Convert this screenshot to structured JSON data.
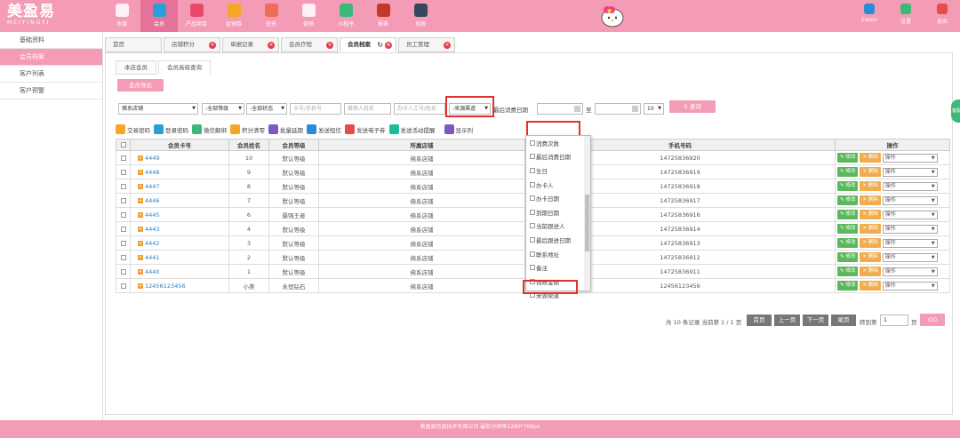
{
  "app": {
    "logo_cn": "美盈易",
    "logo_en": "MEIYINGYI"
  },
  "nav": [
    {
      "label": "收银",
      "icon": "cash-register-icon",
      "color": "#ffffff"
    },
    {
      "label": "会员",
      "icon": "member-icon",
      "color": "#2aa0d8"
    },
    {
      "label": "产品项目",
      "icon": "product-icon",
      "color": "#e84b6a"
    },
    {
      "label": "促销券",
      "icon": "coupon-icon",
      "color": "#f5a623"
    },
    {
      "label": "短充",
      "icon": "recharge-icon",
      "color": "#ef6b5a"
    },
    {
      "label": "营销",
      "icon": "marketing-icon",
      "color": "#ffffff"
    },
    {
      "label": "小程序",
      "icon": "mini-program-icon",
      "color": "#3cb878"
    },
    {
      "label": "报表",
      "icon": "report-icon",
      "color": "#c0392b"
    },
    {
      "label": "系统",
      "icon": "system-icon",
      "color": "#34495e"
    }
  ],
  "topright": [
    {
      "label": "Eason",
      "icon": "user-icon",
      "color": "#2a8cd8"
    },
    {
      "label": "设置",
      "icon": "settings-icon",
      "color": "#3cb878"
    },
    {
      "label": "退出",
      "icon": "logout-icon",
      "color": "#e84b4b"
    }
  ],
  "sidebar": [
    {
      "label": "基础资料"
    },
    {
      "label": "会员档案"
    },
    {
      "label": "客户列表"
    },
    {
      "label": "客户预警"
    }
  ],
  "tabs": [
    {
      "label": "首页",
      "w": 64
    },
    {
      "label": "店铺积分",
      "w": 64
    },
    {
      "label": "单据记录",
      "w": 64
    },
    {
      "label": "会员疗程",
      "w": 64
    },
    {
      "label": "会员档案",
      "w": 64
    },
    {
      "label": "员工管理",
      "w": 64
    }
  ],
  "subtabs": [
    "本店会员",
    "会员高级查询"
  ],
  "export_btn": "会员导出",
  "filters": {
    "store": "佛系店铺",
    "level": "-全部等级",
    "status": "-全部状态",
    "card_placeholder": "卡号/手机号",
    "recommender_placeholder": "推荐人姓名",
    "staff_placeholder": "办卡人工号/姓名",
    "source": "-来源渠道",
    "last_consume_label": "最后消费日期",
    "to_label": "至",
    "page_size": "10",
    "query_btn": "查询"
  },
  "quick": [
    {
      "label": "交易密码",
      "color": "#f5a623"
    },
    {
      "label": "登录密码",
      "color": "#2aa0d8"
    },
    {
      "label": "微信解绑",
      "color": "#3cb878"
    },
    {
      "label": "积分清零",
      "color": "#f5a623"
    },
    {
      "label": "批量延期",
      "color": "#7e57c2"
    },
    {
      "label": "发送短信",
      "color": "#2a8cd8"
    },
    {
      "label": "发送电子券",
      "color": "#e84b4b"
    },
    {
      "label": "发送活动提醒",
      "color": "#1abc9c"
    },
    {
      "label": "显示列",
      "color": "#7e57c2"
    }
  ],
  "table": {
    "headers": [
      "会员卡号",
      "会员姓名",
      "会员等级",
      "所属店铺",
      "手机号码",
      "操作"
    ],
    "edit": "修改",
    "delete": "删除",
    "op": "操作",
    "rows": [
      {
        "card": "4449",
        "name": "10",
        "level": "默认等级",
        "store": "佛系店铺",
        "phone": "14725836920"
      },
      {
        "card": "4448",
        "name": "9",
        "level": "默认等级",
        "store": "佛系店铺",
        "phone": "14725836919"
      },
      {
        "card": "4447",
        "name": "8",
        "level": "默认等级",
        "store": "佛系店铺",
        "phone": "14725836918"
      },
      {
        "card": "4446",
        "name": "7",
        "level": "默认等级",
        "store": "佛系店铺",
        "phone": "14725836917"
      },
      {
        "card": "4445",
        "name": "6",
        "level": "最强王者",
        "store": "佛系店铺",
        "phone": "14725836916"
      },
      {
        "card": "4443",
        "name": "4",
        "level": "默认等级",
        "store": "佛系店铺",
        "phone": "14725836914"
      },
      {
        "card": "4442",
        "name": "3",
        "level": "默认等级",
        "store": "佛系店铺",
        "phone": "14725836913"
      },
      {
        "card": "4441",
        "name": "2",
        "level": "默认等级",
        "store": "佛系店铺",
        "phone": "14725836912"
      },
      {
        "card": "4440",
        "name": "1",
        "level": "默认等级",
        "store": "佛系店铺",
        "phone": "14725836911"
      },
      {
        "card": "12456123456",
        "name": "小美",
        "level": "永恒钻石",
        "store": "佛系店铺",
        "phone": "12456123456"
      }
    ]
  },
  "columns_dropdown": [
    "消费次数",
    "最后消费日期",
    "生日",
    "办卡人",
    "办卡日期",
    "到期日期",
    "当前跟进人",
    "最后跟进日期",
    "联系地址",
    "备注",
    "钱账金额",
    "来源渠道"
  ],
  "pager": {
    "summary": "共 10 条记录 当前第 1 / 1 页",
    "first": "首页",
    "prev": "上一页",
    "next": "下一页",
    "last": "尾页",
    "goto_label": "转到第",
    "goto_value": "1",
    "page_unit": "页",
    "go": "GO"
  },
  "footer": "美盈易信息技术有限公司    最低分辨率1280*768px",
  "side_tab": "客服"
}
